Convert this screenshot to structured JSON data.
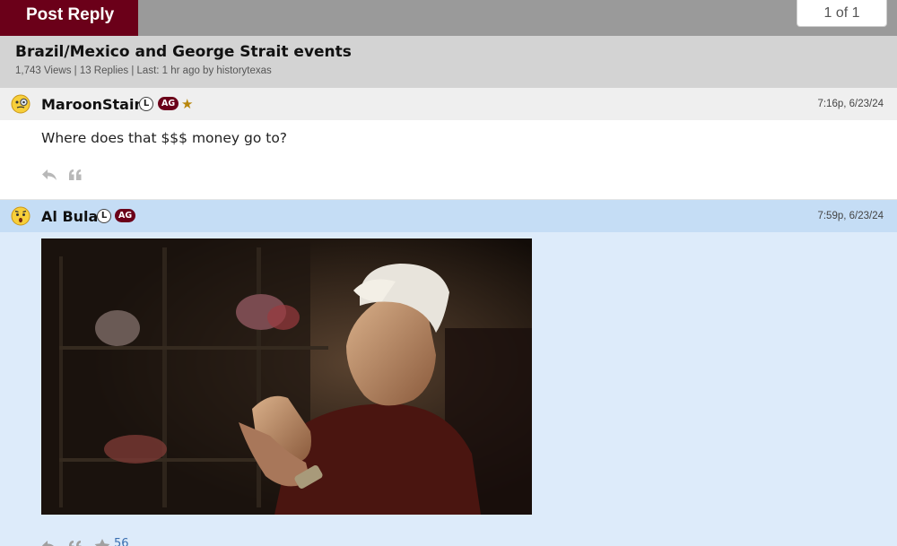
{
  "toolbar": {
    "post_reply_label": "Post Reply",
    "page_indicator": "1 of 1"
  },
  "thread": {
    "title": "Brazil/Mexico and George Strait events",
    "meta": "1,743 Views | 13 Replies | Last: 1 hr ago by historytexas"
  },
  "posts": [
    {
      "username": "MaroonStain",
      "badge_l": "L",
      "badge_ag": "AG",
      "timestamp": "7:16p, 6/23/24",
      "text": "Where does that $$$ money go to?",
      "avatar_icon": "monocle-face-icon"
    },
    {
      "username": "Al Bula",
      "badge_l": "L",
      "badge_ag": "AG",
      "timestamp": "7:59p, 6/23/24",
      "likes": "56",
      "avatar_icon": "surprised-face-icon"
    }
  ],
  "colors": {
    "maroon": "#6b0019",
    "header_gray": "#d3d3d3",
    "highlight_blue": "#c5ddf5",
    "post_blue": "#ddebfa"
  }
}
